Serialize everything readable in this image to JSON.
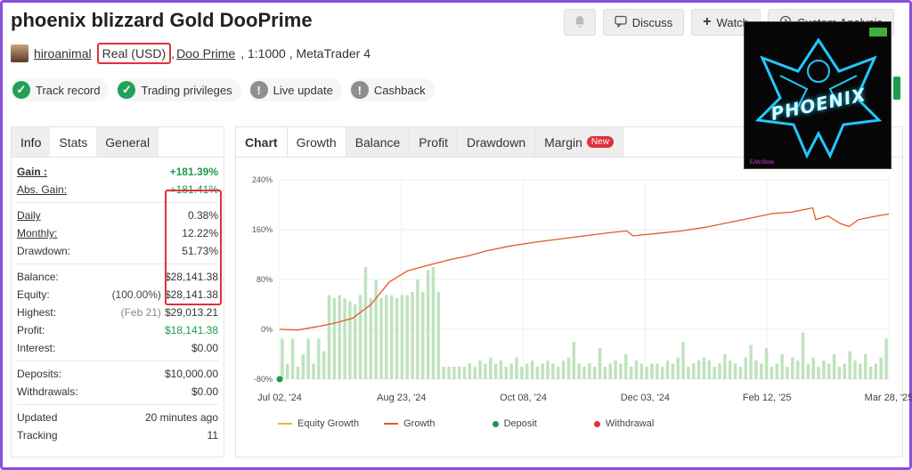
{
  "title": "phoenix blizzard Gold DooPrime",
  "top_buttons": {
    "discuss": "Discuss",
    "watch": "Watch",
    "custom": "Custom Analysis"
  },
  "account": {
    "user": "hiroanimal",
    "type": "Real (USD)",
    "sep1": ",",
    "broker": "Doo Prime",
    "rest": ", 1:1000 , MetaTrader 4"
  },
  "badges": [
    {
      "label": "Track record",
      "status": "ok"
    },
    {
      "label": "Trading privileges",
      "status": "ok"
    },
    {
      "label": "Live update",
      "status": "info"
    },
    {
      "label": "Cashback",
      "status": "info"
    }
  ],
  "left_tabs": [
    "Info",
    "Stats",
    "General"
  ],
  "stats": {
    "gain": {
      "label": "Gain :",
      "value": "+181.39%"
    },
    "abs_gain": {
      "label": "Abs. Gain:",
      "value": "+181.41%"
    },
    "daily": {
      "label": "Daily",
      "value": "0.38%"
    },
    "monthly": {
      "label": "Monthly:",
      "value": "12.22%"
    },
    "drawdown": {
      "label": "Drawdown:",
      "value": "51.73%"
    },
    "balance": {
      "label": "Balance:",
      "value": "$28,141.38"
    },
    "equity": {
      "label": "Equity:",
      "pct": "(100.00%)",
      "value": "$28,141.38"
    },
    "highest": {
      "label": "Highest:",
      "date": "(Feb 21)",
      "value": "$29,013.21"
    },
    "profit": {
      "label": "Profit:",
      "value": "$18,141.38"
    },
    "interest": {
      "label": "Interest:",
      "value": "$0.00"
    },
    "deposits": {
      "label": "Deposits:",
      "value": "$10,000.00"
    },
    "withdrawals": {
      "label": "Withdrawals:",
      "value": "$0.00"
    },
    "updated": {
      "label": "Updated",
      "value": "20 minutes ago"
    },
    "tracking": {
      "label": "Tracking",
      "value": "11"
    }
  },
  "right_tabs": [
    "Chart",
    "Growth",
    "Balance",
    "Profit",
    "Drawdown",
    "Margin"
  ],
  "new_badge": "New",
  "promo": {
    "text": "PHOENIX",
    "small": "EAfxStore"
  },
  "colors": {
    "growth": "#e05a28",
    "equity": "#e3b73a",
    "deposit": "#1d9a4a",
    "withdrawal": "#e0303a",
    "bars": "#bfe3bf",
    "accent_red": "#e0303a"
  },
  "chart_data": {
    "type": "line",
    "yticks": [
      "240%",
      "160%",
      "80%",
      "0%",
      "-80%"
    ],
    "ylim": [
      -80,
      240
    ],
    "xticks": [
      "Jul 02, '24",
      "Aug 23, '24",
      "Oct 08, '24",
      "Dec 03, '24",
      "Feb 12, '25",
      "Mar 28, '25"
    ],
    "legend": [
      "Equity Growth",
      "Growth",
      "Deposit",
      "Withdrawal"
    ],
    "series": [
      {
        "name": "Growth",
        "points": [
          [
            0,
            0
          ],
          [
            0.03,
            -1
          ],
          [
            0.06,
            4
          ],
          [
            0.09,
            10
          ],
          [
            0.12,
            18
          ],
          [
            0.15,
            40
          ],
          [
            0.18,
            76
          ],
          [
            0.21,
            94
          ],
          [
            0.24,
            102
          ],
          [
            0.28,
            112
          ],
          [
            0.31,
            118
          ],
          [
            0.34,
            126
          ],
          [
            0.38,
            134
          ],
          [
            0.42,
            140
          ],
          [
            0.46,
            145
          ],
          [
            0.5,
            150
          ],
          [
            0.54,
            155
          ],
          [
            0.57,
            158
          ],
          [
            0.58,
            150
          ],
          [
            0.62,
            154
          ],
          [
            0.66,
            158
          ],
          [
            0.7,
            164
          ],
          [
            0.74,
            172
          ],
          [
            0.78,
            180
          ],
          [
            0.81,
            186
          ],
          [
            0.84,
            188
          ],
          [
            0.86,
            192
          ],
          [
            0.875,
            195
          ],
          [
            0.88,
            176
          ],
          [
            0.9,
            182
          ],
          [
            0.92,
            170
          ],
          [
            0.935,
            165
          ],
          [
            0.95,
            176
          ],
          [
            0.98,
            182
          ],
          [
            1,
            185
          ]
        ]
      }
    ],
    "bars": [
      -15,
      -55,
      -15,
      -60,
      -40,
      -15,
      -55,
      -15,
      -35,
      55,
      50,
      55,
      50,
      45,
      40,
      55,
      100,
      50,
      80,
      50,
      55,
      55,
      50,
      55,
      55,
      60,
      80,
      60,
      95,
      100,
      60,
      -60,
      -60,
      -60,
      -60,
      -60,
      -55,
      -60,
      -50,
      -55,
      -45,
      -55,
      -50,
      -60,
      -55,
      -45,
      -60,
      -55,
      -50,
      -60,
      -55,
      -50,
      -55,
      -60,
      -50,
      -45,
      -20,
      -55,
      -60,
      -55,
      -60,
      -30,
      -60,
      -55,
      -50,
      -55,
      -40,
      -60,
      -50,
      -55,
      -60,
      -55,
      -55,
      -60,
      -50,
      -55,
      -45,
      -20,
      -60,
      -55,
      -50,
      -45,
      -50,
      -60,
      -55,
      -40,
      -50,
      -55,
      -60,
      -45,
      -25,
      -50,
      -55,
      -30,
      -60,
      -55,
      -40,
      -60,
      -45,
      -50,
      -5,
      -55,
      -45,
      -60,
      -50,
      -55,
      -40,
      -60,
      -55,
      -35,
      -50,
      -55,
      -40,
      -60,
      -55,
      -45,
      -15
    ]
  }
}
